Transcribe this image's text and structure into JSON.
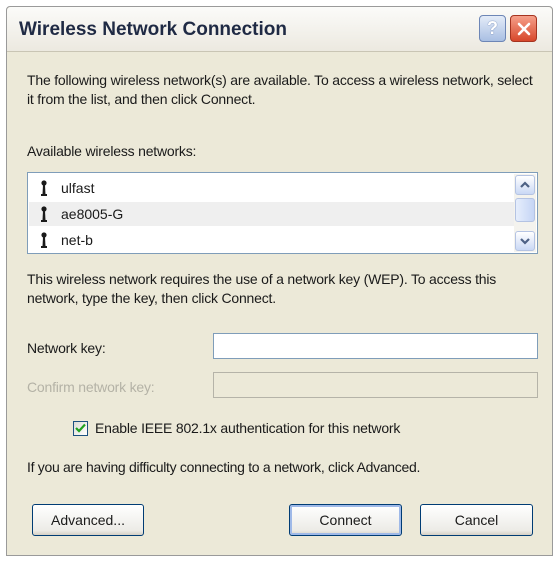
{
  "window": {
    "title": "Wireless Network Connection",
    "help_label": "?"
  },
  "intro_text": "The following wireless network(s) are available. To access a wireless network, select it from the list, and then click Connect.",
  "networks_label": "Available wireless networks:",
  "networks": [
    {
      "name": "ulfast",
      "selected": false
    },
    {
      "name": "ae8005-G",
      "selected": true
    },
    {
      "name": "net-b",
      "selected": false
    }
  ],
  "wep_text": "This wireless network requires the use of a network key (WEP). To access this network, type the key, then click Connect.",
  "network_key": {
    "label": "Network key:",
    "value": ""
  },
  "confirm_key": {
    "label": "Confirm network key:",
    "value": ""
  },
  "checkbox": {
    "label": "Enable IEEE 802.1x authentication for this network",
    "checked": true
  },
  "advanced_hint": "If you are having difficulty connecting to a network, click Advanced.",
  "buttons": {
    "advanced": "Advanced...",
    "connect": "Connect",
    "cancel": "Cancel"
  },
  "colors": {
    "dialog_background": "#ece9d8",
    "title_text": "#1f2a44",
    "close_button": "#d7472b",
    "help_button": "#a9bfe3",
    "checkmark": "#21a121"
  },
  "icons": {
    "network": "wireless-antenna-icon",
    "scroll_up": "chevron-up-icon",
    "scroll_down": "chevron-down-icon",
    "close": "close-icon",
    "check": "checkmark-icon"
  }
}
